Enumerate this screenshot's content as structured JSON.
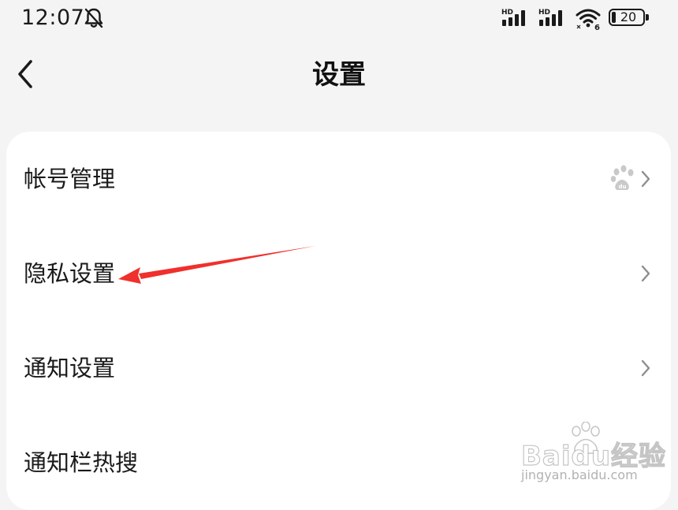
{
  "status_bar": {
    "time": "12:07",
    "battery_level": "20",
    "icons": [
      "bell-off-icon",
      "hd-signal-icon",
      "hd-signal-icon",
      "wifi-6-icon",
      "battery-icon"
    ]
  },
  "header": {
    "title": "设置",
    "back_icon": "chevron-left-icon"
  },
  "settings": {
    "items": [
      {
        "label": "帐号管理",
        "trailing_icon": "baidu-paw-icon"
      },
      {
        "label": "隐私设置"
      },
      {
        "label": "通知设置"
      },
      {
        "label": "通知栏热搜"
      }
    ]
  },
  "annotation": {
    "type": "red-arrow",
    "color": "#f0302c",
    "points_to": "隐私设置"
  },
  "watermark": {
    "main": "Baidu经验",
    "sub": "jingyan.baidu.com"
  },
  "colors": {
    "background": "#f4f4f4",
    "card": "#ffffff",
    "text": "#1a1a1a",
    "chevron": "#8e8e8e",
    "arrow": "#f0302c"
  }
}
